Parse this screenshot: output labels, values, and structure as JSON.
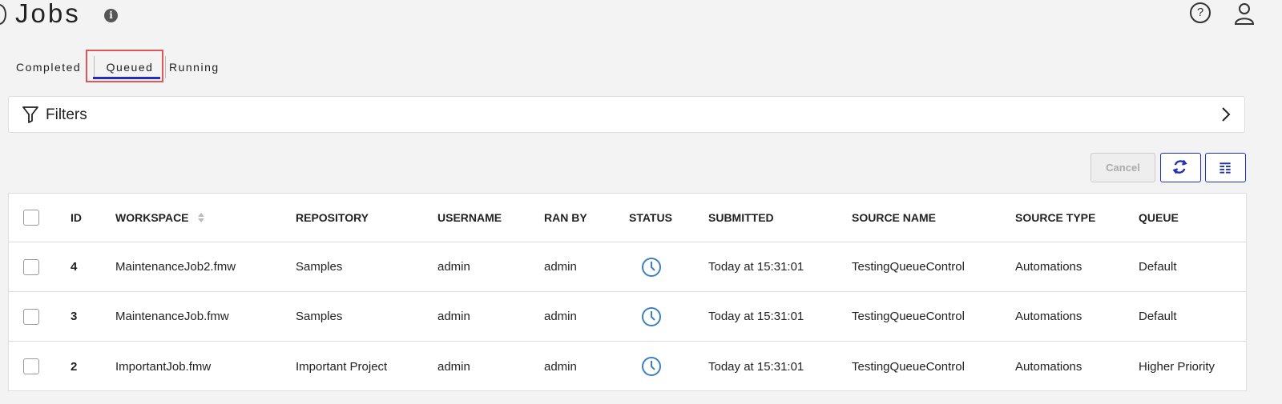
{
  "header": {
    "title": "Jobs",
    "info_icon": "info-icon",
    "help_icon": "help-icon",
    "user_icon": "user-icon"
  },
  "tabs": [
    {
      "label": "Completed",
      "active": false
    },
    {
      "label": "Queued",
      "active": true
    },
    {
      "label": "Running",
      "active": false
    }
  ],
  "filters": {
    "label": "Filters",
    "icon": "filter-icon",
    "expand_icon": "chevron-right-icon"
  },
  "toolbar": {
    "cancel_label": "Cancel",
    "refresh_icon": "refresh-icon",
    "columns_icon": "columns-icon"
  },
  "colors": {
    "accent": "#1f2fb8",
    "status_icon": "#3a7fc0",
    "highlight": "#e05555"
  },
  "table": {
    "columns": [
      "ID",
      "WORKSPACE",
      "REPOSITORY",
      "USERNAME",
      "RAN BY",
      "STATUS",
      "SUBMITTED",
      "SOURCE NAME",
      "SOURCE TYPE",
      "QUEUE"
    ],
    "sorted_column": "WORKSPACE",
    "rows": [
      {
        "id": "4",
        "workspace": "MaintenanceJob2.fmw",
        "repository": "Samples",
        "username": "admin",
        "ran_by": "admin",
        "status": "queued-clock-icon",
        "submitted": "Today at 15:31:01",
        "source_name": "TestingQueueControl",
        "source_type": "Automations",
        "queue": "Default"
      },
      {
        "id": "3",
        "workspace": "MaintenanceJob.fmw",
        "repository": "Samples",
        "username": "admin",
        "ran_by": "admin",
        "status": "queued-clock-icon",
        "submitted": "Today at 15:31:01",
        "source_name": "TestingQueueControl",
        "source_type": "Automations",
        "queue": "Default"
      },
      {
        "id": "2",
        "workspace": "ImportantJob.fmw",
        "repository": "Important Project",
        "username": "admin",
        "ran_by": "admin",
        "status": "queued-clock-icon",
        "submitted": "Today at 15:31:01",
        "source_name": "TestingQueueControl",
        "source_type": "Automations",
        "queue": "Higher Priority"
      }
    ]
  }
}
